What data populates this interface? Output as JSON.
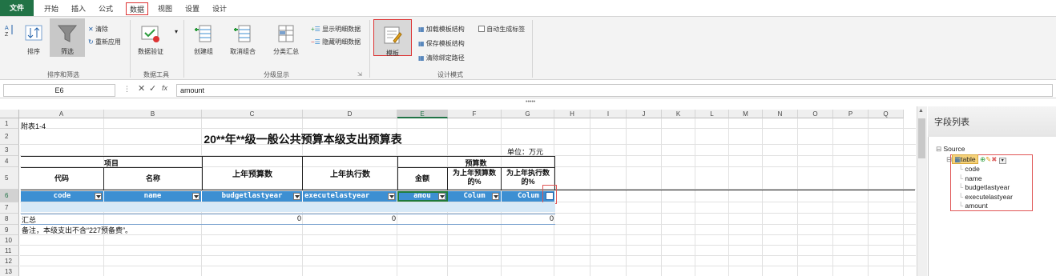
{
  "tabs": {
    "file": "文件",
    "home": "开始",
    "insert": "插入",
    "formulas": "公式",
    "data": "数据",
    "view": "视图",
    "settings": "设置",
    "design": "设计"
  },
  "ribbon": {
    "sort_label": "排序",
    "filter_label": "筛选",
    "clear_label": "清除",
    "reapply_label": "重新应用",
    "sort_filter_group": "排序和筛选",
    "validation_label": "数据验证",
    "data_tools_group": "数据工具",
    "group_label": "创建组",
    "ungroup_label": "取消组合",
    "subtotal_label": "分类汇总",
    "show_detail_label": "显示明细数据",
    "hide_detail_label": "隐藏明细数据",
    "outline_group": "分级显示",
    "template_label": "模板",
    "load_template_label": "加载模板结构",
    "save_template_label": "保存模板结构",
    "clear_bind_label": "清除绑定路径",
    "auto_label_checkbox": "自动生成标签",
    "design_mode_group": "设计模式"
  },
  "formula_bar": {
    "name_box": "E6",
    "fx": "fx",
    "value": "amount"
  },
  "columns": [
    "A",
    "B",
    "C",
    "D",
    "E",
    "F",
    "G",
    "H",
    "I",
    "J",
    "K",
    "L",
    "M",
    "N",
    "O",
    "P",
    "Q"
  ],
  "rows": [
    "1",
    "2",
    "3",
    "4",
    "5",
    "6",
    "7",
    "8",
    "9",
    "10",
    "11",
    "12",
    "13"
  ],
  "sheet": {
    "a1": "附表1-4",
    "title": "20**年**级一般公共预算本级支出预算表",
    "unit": "单位：万元",
    "h_item": "项目",
    "h_code": "代码",
    "h_name": "名称",
    "h_last_budget": "上年预算数",
    "h_last_exec": "上年执行数",
    "h_budget": "预算数",
    "h_amount": "金额",
    "h_pct_budget": "为上年预算数的%",
    "h_pct_exec": "为上年执行数的%",
    "fields": [
      "code",
      "name",
      "budgetlastyear",
      "executelastyear",
      "amou",
      "Colum",
      "Colum"
    ],
    "total_label": "汇总",
    "total_c": "0",
    "total_d": "0",
    "total_g": "0",
    "note": "备注，本级支出不含“227预备费”。"
  },
  "panel": {
    "title": "字段列表",
    "source": "Source",
    "table": "table",
    "fields": [
      "code",
      "name",
      "budgetlastyear",
      "executelastyear",
      "amount"
    ]
  },
  "colors": {
    "accent": "#217346",
    "field_blue": "#3d8fd2",
    "highlight_red": "#d33"
  }
}
